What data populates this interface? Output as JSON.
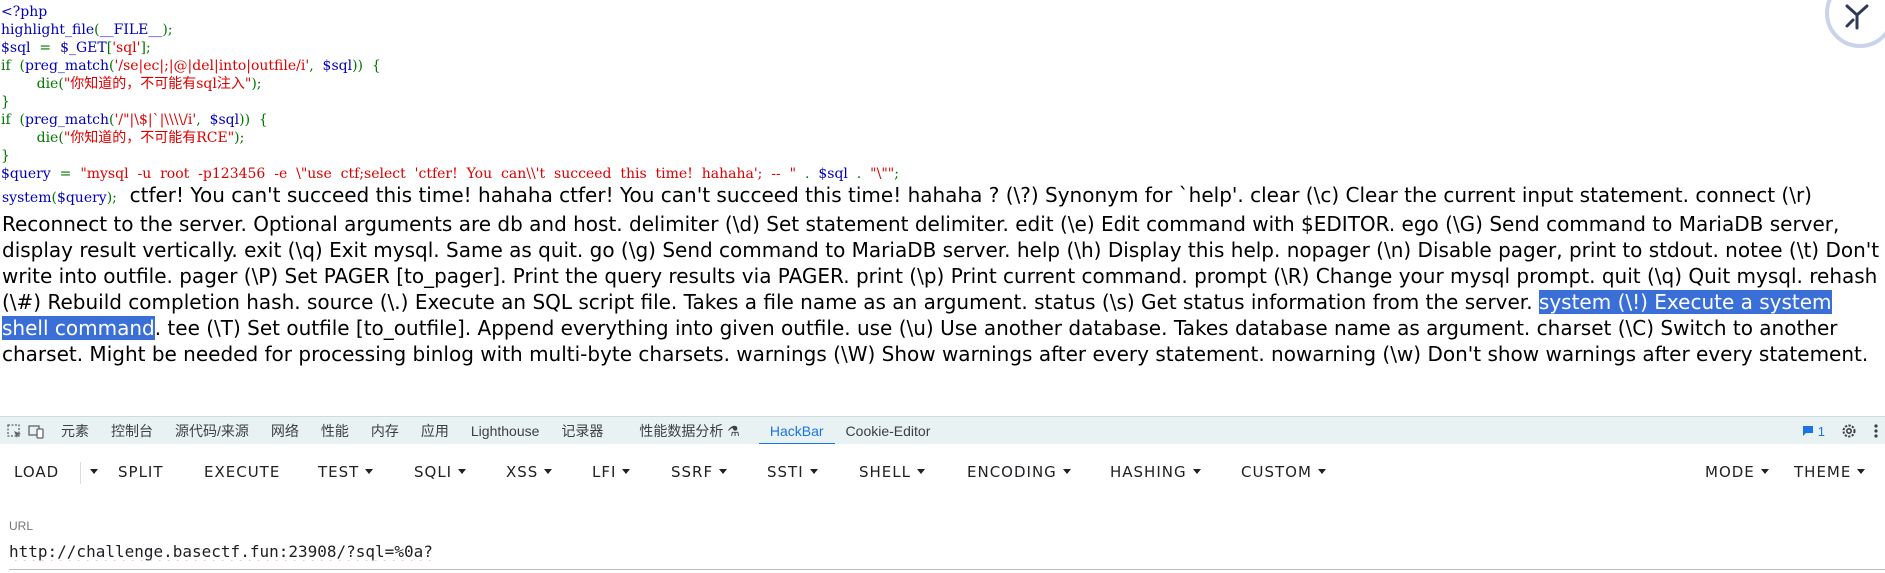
{
  "code": {
    "open_tag": "<?php",
    "l2_fn": "highlight_file",
    "l2_open": "(",
    "l2_const": "__FILE__",
    "l2_close": ");",
    "l3_var": "$sql",
    "l3_eq": "  =  ",
    "l3_get": "$_GET",
    "l3_open": "[",
    "l3_key": "'sql'",
    "l3_close": "];",
    "l4_if": "if  (",
    "l4_fn": "preg_match",
    "l4_open": "(",
    "l4_pattern": "'/se|ec|;|@|del|into|outfile/i'",
    "l4_comma": ",  ",
    "l4_var": "$sql",
    "l4_close": "))  {",
    "l5_indent": "        ",
    "l5_die": "die",
    "l5_open": "(",
    "l5_msg": "\"你知道的，不可能有sql注入\"",
    "l5_close": ");",
    "l6_brace": "}",
    "l7_if": "if  (",
    "l7_fn": "preg_match",
    "l7_open": "(",
    "l7_pattern": "'/\"|\\$|`|\\\\\\\\/i'",
    "l7_comma": ",  ",
    "l7_var": "$sql",
    "l7_close": "))  {",
    "l8_indent": "        ",
    "l8_die": "die",
    "l8_open": "(",
    "l8_msg": "\"你知道的，不可能有RCE\"",
    "l8_close": ");",
    "l9_brace": "}",
    "l10_var": "$query",
    "l10_eq": "  =  ",
    "l10_str1": "\"mysql  -u  root  -p123456  -e  \\\"use  ctf;select  'ctfer!  You  can\\\\'t  succeed  this  time!  hahaha';  --  \"",
    "l10_dot1": "  .  ",
    "l10_var2": "$sql",
    "l10_dot2": "  .  ",
    "l10_str2": "\"\\\"\"",
    "l10_end": ";",
    "l11_fn": "system",
    "l11_open": "(",
    "l11_var": "$query",
    "l11_close": ");"
  },
  "output": {
    "before_highlight": "ctfer! You can't succeed this time! hahaha ctfer! You can't succeed this time! hahaha ? (\\?) Synonym for `help'. clear (\\c) Clear the current input statement. connect (\\r) Reconnect to the server. Optional arguments are db and host. delimiter (\\d) Set statement delimiter. edit (\\e) Edit command with $EDITOR. ego (\\G) Send command to MariaDB server, display result vertically. exit (\\q) Exit mysql. Same as quit. go (\\g) Send command to MariaDB server. help (\\h) Display this help. nopager (\\n) Disable pager, print to stdout. notee (\\t) Don't write into outfile. pager (\\P) Set PAGER [to_pager]. Print the query results via PAGER. print (\\p) Print current command. prompt (\\R) Change your mysql prompt. quit (\\q) Quit mysql. rehash (\\#) Rebuild completion hash. source (\\.) Execute an SQL script file. Takes a file name as an argument. status (\\s) Get status information from the server. ",
    "highlighted": "system (\\!) Execute a system shell command",
    "after_highlight": ". tee (\\T) Set outfile [to_outfile]. Append everything into given outfile. use (\\u) Use another database. Takes database name as argument. charset (\\C) Switch to another charset. Might be needed for processing binlog with multi-byte charsets. warnings (\\W) Show warnings after every statement. nowarning (\\w) Don't show warnings after every statement."
  },
  "devtools": {
    "tabs": [
      "元素",
      "控制台",
      "源代码/来源",
      "网络",
      "性能",
      "内存",
      "应用",
      "Lighthouse",
      "记录器",
      "性能数据分析 ⚗",
      "HackBar",
      "Cookie-Editor"
    ],
    "active_tab": "HackBar",
    "issues_count": "1",
    "icons": [
      "inspect-icon",
      "device-toolbar-icon",
      "settings-gear-icon",
      "more-vert-icon",
      "issues-icon"
    ]
  },
  "hackbar": {
    "buttons": {
      "load": "LOAD",
      "split": "SPLIT",
      "execute": "EXECUTE",
      "test": "TEST",
      "sqli": "SQLI",
      "xss": "XSS",
      "lfi": "LFI",
      "ssrf": "SSRF",
      "ssti": "SSTI",
      "shell": "SHELL",
      "encoding": "ENCODING",
      "hashing": "HASHING",
      "custom": "CUSTOM",
      "mode": "MODE",
      "theme": "THEME"
    },
    "url_label": "URL",
    "url_value": "http://challenge.basectf.fun:23908/?sql=%0a?"
  },
  "colors": {
    "php_keyword": "#007700",
    "php_default": "#0000BB",
    "php_string": "#DD0000",
    "selection": "#3b6fd8",
    "devtools_bar": "#e9f2f3",
    "accent": "#1a73e8"
  }
}
